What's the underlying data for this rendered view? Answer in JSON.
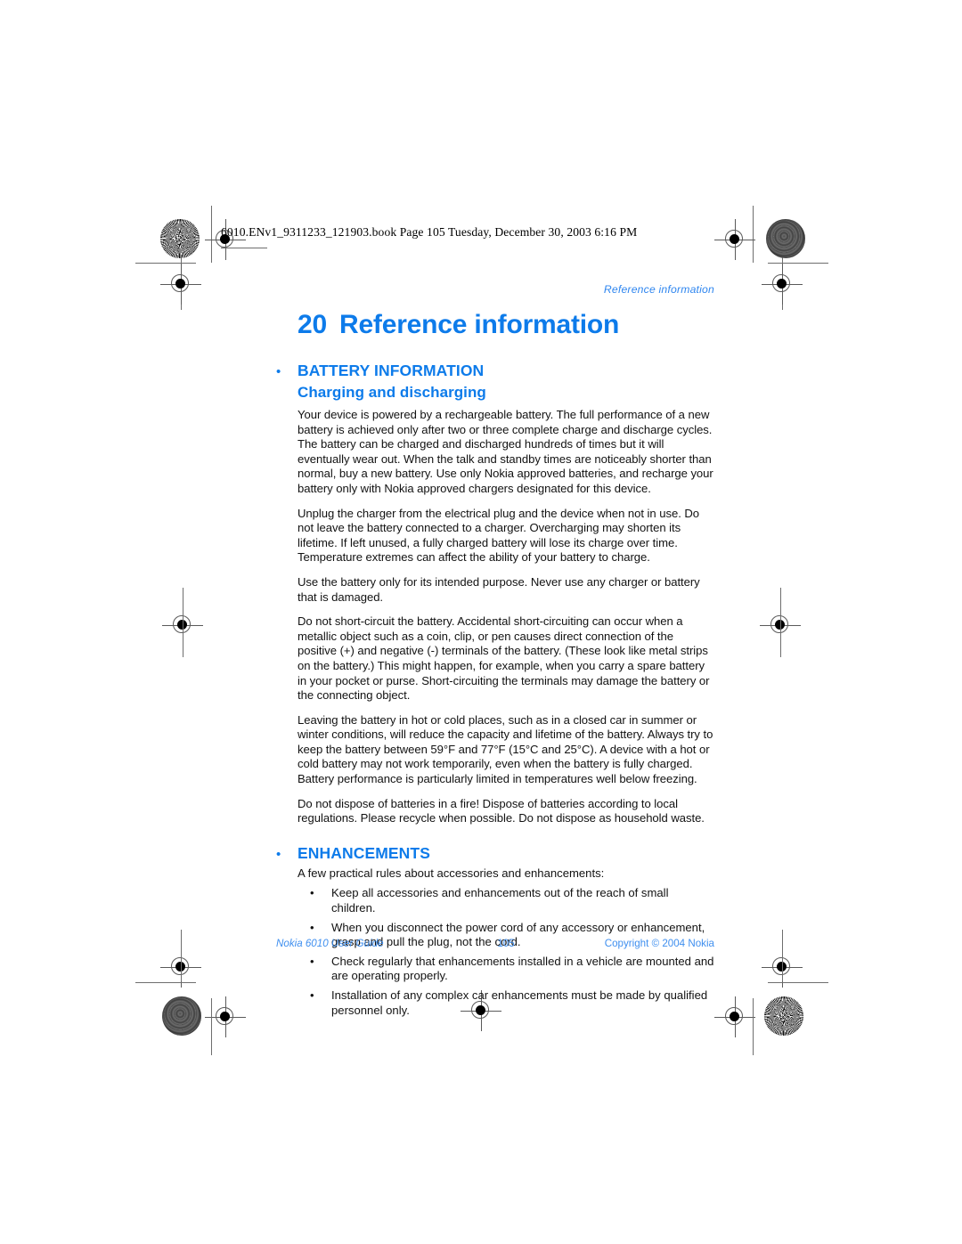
{
  "document": {
    "file_slug": "6010.ENv1_9311233_121903.book  Page 105  Tuesday, December 30, 2003  6:16 PM",
    "running_head": "Reference information",
    "accent_color": "#0d7bea",
    "footer_color": "#3f8fef",
    "body_color": "#121212"
  },
  "chapter": {
    "number": "20",
    "title": "Reference information"
  },
  "sections": [
    {
      "heading": "BATTERY INFORMATION",
      "subheading": "Charging and discharging",
      "paragraphs": [
        "Your device is powered by a rechargeable battery. The full performance of a new battery is achieved only after two or three complete charge and discharge cycles. The battery can be charged and discharged hundreds of times but it will eventually wear out. When the talk and standby times are noticeably shorter than normal, buy a new battery. Use only Nokia approved batteries, and recharge your battery only with Nokia approved chargers designated for this device.",
        "Unplug the charger from the electrical plug and the device when not in use. Do not leave the battery connected to a charger. Overcharging may shorten its lifetime. If left unused, a fully charged battery will lose its charge over time. Temperature extremes can affect the ability of your battery to charge.",
        "Use the battery only for its intended purpose. Never use any charger or battery that is damaged.",
        "Do not short-circuit the battery. Accidental short-circuiting can occur when a metallic object such as a coin, clip, or pen causes direct connection of the positive (+) and negative (-) terminals of the battery. (These look like metal strips on the battery.) This might happen, for example, when you carry a spare battery in your pocket or purse. Short-circuiting the terminals may damage the battery or the connecting object.",
        "Leaving the battery in hot or cold places, such as in a closed car in summer or winter conditions, will reduce the capacity and lifetime of the battery. Always try to keep the battery between 59°F and 77°F (15°C and 25°C). A device with a hot or cold battery may not work temporarily, even when the battery is fully charged. Battery performance is particularly limited in temperatures well below freezing.",
        "Do not dispose of batteries in a fire! Dispose of batteries according to local regulations. Please recycle when possible. Do not dispose as household waste."
      ]
    },
    {
      "heading": "ENHANCEMENTS",
      "intro": "A few practical rules about accessories and enhancements:",
      "bullets": [
        "Keep all accessories and enhancements out of the reach of small children.",
        "When you disconnect the power cord of any accessory or enhancement, grasp and pull the plug, not the cord.",
        "Check regularly that enhancements installed in a vehicle are mounted and are operating properly.",
        "Installation of any complex car enhancements must be made by qualified personnel only."
      ],
      "bullet_glyph": "•"
    }
  ],
  "heading_bullet_glyph": "•",
  "footer": {
    "left": "Nokia 6010 User Guide",
    "page_number": "105",
    "right": "Copyright © 2004 Nokia"
  }
}
